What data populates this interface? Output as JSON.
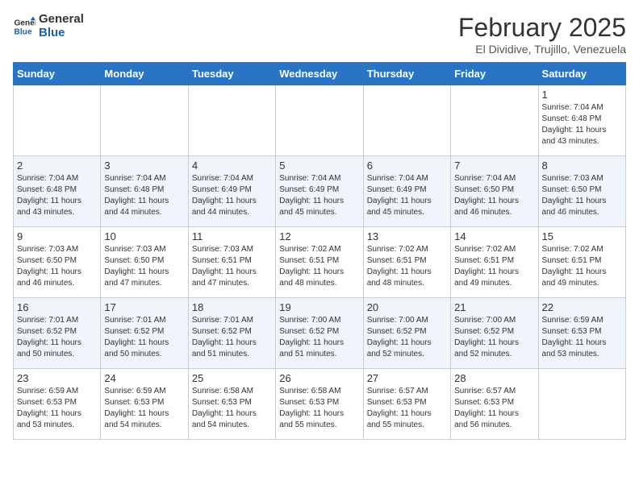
{
  "header": {
    "logo_general": "General",
    "logo_blue": "Blue",
    "month_title": "February 2025",
    "subtitle": "El Dividive, Trujillo, Venezuela"
  },
  "days_of_week": [
    "Sunday",
    "Monday",
    "Tuesday",
    "Wednesday",
    "Thursday",
    "Friday",
    "Saturday"
  ],
  "weeks": [
    [
      {
        "day": "",
        "info": ""
      },
      {
        "day": "",
        "info": ""
      },
      {
        "day": "",
        "info": ""
      },
      {
        "day": "",
        "info": ""
      },
      {
        "day": "",
        "info": ""
      },
      {
        "day": "",
        "info": ""
      },
      {
        "day": "1",
        "info": "Sunrise: 7:04 AM\nSunset: 6:48 PM\nDaylight: 11 hours\nand 43 minutes."
      }
    ],
    [
      {
        "day": "2",
        "info": "Sunrise: 7:04 AM\nSunset: 6:48 PM\nDaylight: 11 hours\nand 43 minutes."
      },
      {
        "day": "3",
        "info": "Sunrise: 7:04 AM\nSunset: 6:48 PM\nDaylight: 11 hours\nand 44 minutes."
      },
      {
        "day": "4",
        "info": "Sunrise: 7:04 AM\nSunset: 6:49 PM\nDaylight: 11 hours\nand 44 minutes."
      },
      {
        "day": "5",
        "info": "Sunrise: 7:04 AM\nSunset: 6:49 PM\nDaylight: 11 hours\nand 45 minutes."
      },
      {
        "day": "6",
        "info": "Sunrise: 7:04 AM\nSunset: 6:49 PM\nDaylight: 11 hours\nand 45 minutes."
      },
      {
        "day": "7",
        "info": "Sunrise: 7:04 AM\nSunset: 6:50 PM\nDaylight: 11 hours\nand 46 minutes."
      },
      {
        "day": "8",
        "info": "Sunrise: 7:03 AM\nSunset: 6:50 PM\nDaylight: 11 hours\nand 46 minutes."
      }
    ],
    [
      {
        "day": "9",
        "info": "Sunrise: 7:03 AM\nSunset: 6:50 PM\nDaylight: 11 hours\nand 46 minutes."
      },
      {
        "day": "10",
        "info": "Sunrise: 7:03 AM\nSunset: 6:50 PM\nDaylight: 11 hours\nand 47 minutes."
      },
      {
        "day": "11",
        "info": "Sunrise: 7:03 AM\nSunset: 6:51 PM\nDaylight: 11 hours\nand 47 minutes."
      },
      {
        "day": "12",
        "info": "Sunrise: 7:02 AM\nSunset: 6:51 PM\nDaylight: 11 hours\nand 48 minutes."
      },
      {
        "day": "13",
        "info": "Sunrise: 7:02 AM\nSunset: 6:51 PM\nDaylight: 11 hours\nand 48 minutes."
      },
      {
        "day": "14",
        "info": "Sunrise: 7:02 AM\nSunset: 6:51 PM\nDaylight: 11 hours\nand 49 minutes."
      },
      {
        "day": "15",
        "info": "Sunrise: 7:02 AM\nSunset: 6:51 PM\nDaylight: 11 hours\nand 49 minutes."
      }
    ],
    [
      {
        "day": "16",
        "info": "Sunrise: 7:01 AM\nSunset: 6:52 PM\nDaylight: 11 hours\nand 50 minutes."
      },
      {
        "day": "17",
        "info": "Sunrise: 7:01 AM\nSunset: 6:52 PM\nDaylight: 11 hours\nand 50 minutes."
      },
      {
        "day": "18",
        "info": "Sunrise: 7:01 AM\nSunset: 6:52 PM\nDaylight: 11 hours\nand 51 minutes."
      },
      {
        "day": "19",
        "info": "Sunrise: 7:00 AM\nSunset: 6:52 PM\nDaylight: 11 hours\nand 51 minutes."
      },
      {
        "day": "20",
        "info": "Sunrise: 7:00 AM\nSunset: 6:52 PM\nDaylight: 11 hours\nand 52 minutes."
      },
      {
        "day": "21",
        "info": "Sunrise: 7:00 AM\nSunset: 6:52 PM\nDaylight: 11 hours\nand 52 minutes."
      },
      {
        "day": "22",
        "info": "Sunrise: 6:59 AM\nSunset: 6:53 PM\nDaylight: 11 hours\nand 53 minutes."
      }
    ],
    [
      {
        "day": "23",
        "info": "Sunrise: 6:59 AM\nSunset: 6:53 PM\nDaylight: 11 hours\nand 53 minutes."
      },
      {
        "day": "24",
        "info": "Sunrise: 6:59 AM\nSunset: 6:53 PM\nDaylight: 11 hours\nand 54 minutes."
      },
      {
        "day": "25",
        "info": "Sunrise: 6:58 AM\nSunset: 6:53 PM\nDaylight: 11 hours\nand 54 minutes."
      },
      {
        "day": "26",
        "info": "Sunrise: 6:58 AM\nSunset: 6:53 PM\nDaylight: 11 hours\nand 55 minutes."
      },
      {
        "day": "27",
        "info": "Sunrise: 6:57 AM\nSunset: 6:53 PM\nDaylight: 11 hours\nand 55 minutes."
      },
      {
        "day": "28",
        "info": "Sunrise: 6:57 AM\nSunset: 6:53 PM\nDaylight: 11 hours\nand 56 minutes."
      },
      {
        "day": "",
        "info": ""
      }
    ]
  ]
}
